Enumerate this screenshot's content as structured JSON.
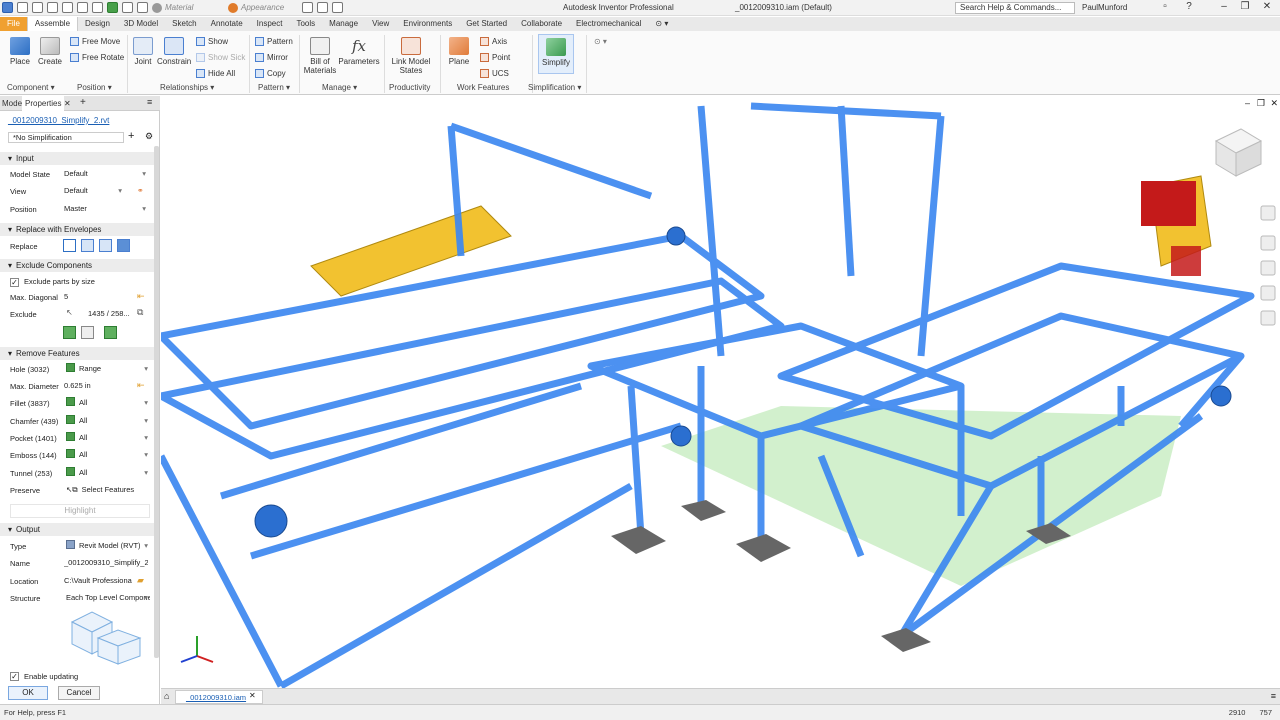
{
  "app": {
    "title": "Autodesk Inventor Professional",
    "document_title": "_0012009310.iam (Default)",
    "search_placeholder": "Search Help & Commands...",
    "user": "PaulMunford",
    "material_label": "Material",
    "appearance_label": "Appearance"
  },
  "ribbon_tabs": [
    "File",
    "Assemble",
    "Design",
    "3D Model",
    "Sketch",
    "Annotate",
    "Inspect",
    "Tools",
    "Manage",
    "View",
    "Environments",
    "Get Started",
    "Collaborate",
    "Electromechanical"
  ],
  "active_tab": "Assemble",
  "ribbon": {
    "place": "Place",
    "create": "Create",
    "free_move": "Free Move",
    "free_rotate": "Free Rotate",
    "joint": "Joint",
    "constrain": "Constrain",
    "show": "Show",
    "show_sick": "Show Sick",
    "hide_all": "Hide All",
    "pattern": "Pattern",
    "mirror": "Mirror",
    "copy": "Copy",
    "bom_line1": "Bill of",
    "bom_line2": "Materials",
    "parameters": "Parameters",
    "link_line1": "Link Model",
    "link_line2": "States",
    "plane": "Plane",
    "axis": "Axis",
    "point": "Point",
    "ucs": "UCS",
    "simplify": "Simplify",
    "groups": {
      "component": "Component",
      "position": "Position",
      "relationships": "Relationships",
      "pattern": "Pattern",
      "manage": "Manage",
      "productivity": "Productivity",
      "work_features": "Work Features",
      "simplification": "Simplification"
    },
    "accent": "#f0a030"
  },
  "panel": {
    "tabs": {
      "model": "Model",
      "properties": "Properties"
    },
    "file_link": "_0012009310_Simplify_2.rvt",
    "simplification": "*No Simplification",
    "input": {
      "header": "Input",
      "model_state_label": "Model State",
      "model_state": "Default",
      "view_label": "View",
      "view": "Default",
      "position_label": "Position",
      "position": "Master"
    },
    "envelopes": {
      "header": "Replace with Envelopes",
      "replace_label": "Replace"
    },
    "exclude": {
      "header": "Exclude Components",
      "exclude_by_size": "Exclude parts by size",
      "max_diagonal_label": "Max. Diagonal",
      "max_diagonal": "5",
      "exclude_label": "Exclude",
      "exclude_value": "1435 / 258..."
    },
    "remove": {
      "header": "Remove Features",
      "rows": [
        {
          "label": "Hole (3032)",
          "value": "Range"
        },
        {
          "label": "Max. Diameter",
          "value": "0.625 in"
        },
        {
          "label": "Fillet (3837)",
          "value": "All"
        },
        {
          "label": "Chamfer (439)",
          "value": "All"
        },
        {
          "label": "Pocket (1401)",
          "value": "All"
        },
        {
          "label": "Emboss (144)",
          "value": "All"
        },
        {
          "label": "Tunnel (253)",
          "value": "All"
        }
      ],
      "preserve_label": "Preserve",
      "preserve_value": "Select Features",
      "highlight": "Highlight"
    },
    "output": {
      "header": "Output",
      "type_label": "Type",
      "type": "Revit Model (RVT)",
      "name_label": "Name",
      "name": "_0012009310_Simplify_2",
      "location_label": "Location",
      "location": "C:\\Vault Professional",
      "structure_label": "Structure",
      "structure": "Each Top Level Component"
    },
    "enable_updating": "Enable updating",
    "ok": "OK",
    "cancel": "Cancel"
  },
  "viewport": {
    "doc_tab": "_0012009310.iam",
    "frame_color": "#4a90f0",
    "highlight_color": "#f2c230",
    "accent_red": "#c41a1a",
    "floor_color": "#b8e8b0"
  },
  "status": {
    "text": "For Help, press F1",
    "x": "2910",
    "y": "757"
  }
}
